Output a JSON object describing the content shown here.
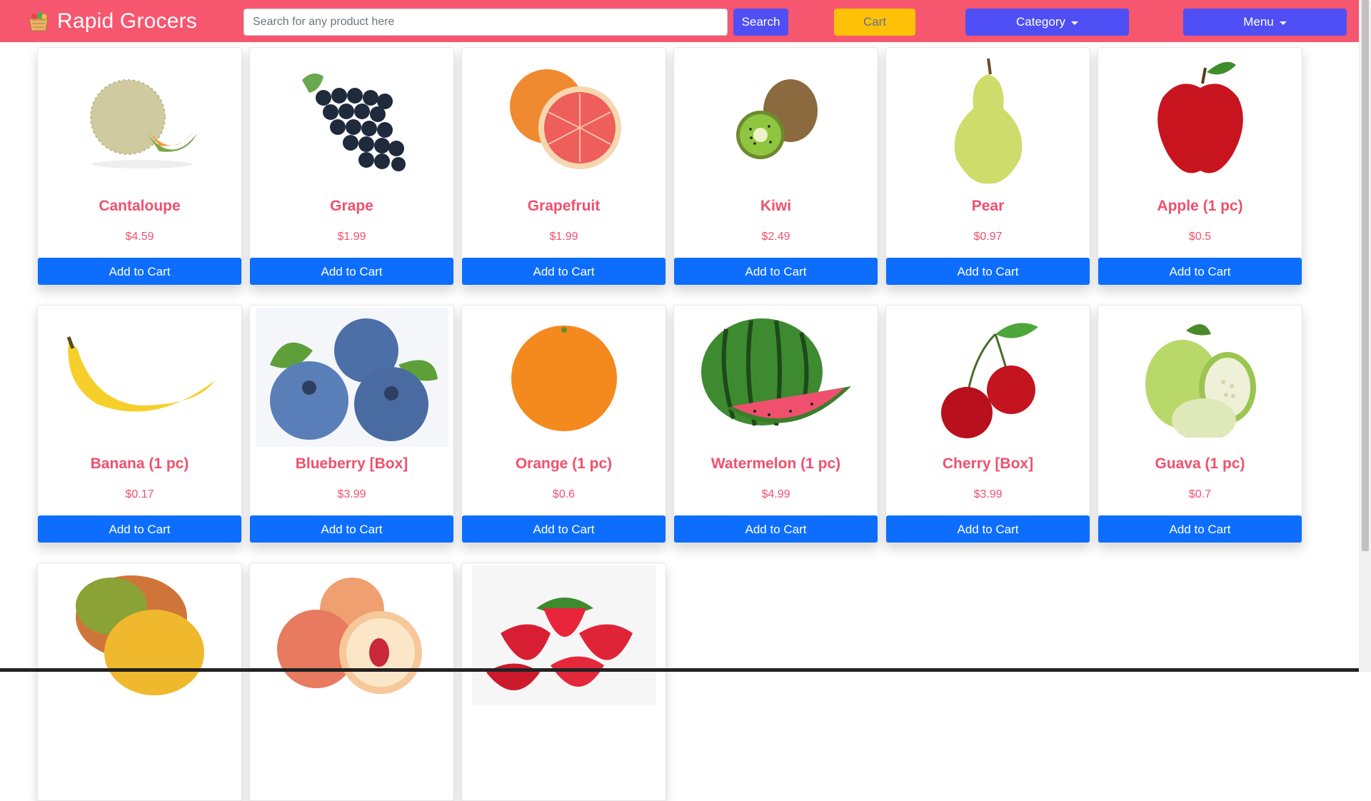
{
  "header": {
    "brand_name": "Rapid Grocers",
    "search_placeholder": "Search for any product here",
    "search_label": "Search",
    "cart_label": "Cart",
    "category_label": "Category",
    "menu_label": "Menu"
  },
  "colors": {
    "navbar": "#f7566f",
    "primary_button": "#4f4ff5",
    "cart_button": "#ffc107",
    "add_to_cart": "#0d6efd",
    "product_text": "#f0506e"
  },
  "products": [
    {
      "name": "Cantaloupe",
      "price": "$4.59",
      "button": "Add to Cart",
      "icon": "cantaloupe-image"
    },
    {
      "name": "Grape",
      "price": "$1.99",
      "button": "Add to Cart",
      "icon": "grape-image"
    },
    {
      "name": "Grapefruit",
      "price": "$1.99",
      "button": "Add to Cart",
      "icon": "grapefruit-image"
    },
    {
      "name": "Kiwi",
      "price": "$2.49",
      "button": "Add to Cart",
      "icon": "kiwi-image"
    },
    {
      "name": "Pear",
      "price": "$0.97",
      "button": "Add to Cart",
      "icon": "pear-image"
    },
    {
      "name": "Apple (1 pc)",
      "price": "$0.5",
      "button": "Add to Cart",
      "icon": "apple-image"
    },
    {
      "name": "Banana (1 pc)",
      "price": "$0.17",
      "button": "Add to Cart",
      "icon": "banana-image"
    },
    {
      "name": "Blueberry [Box]",
      "price": "$3.99",
      "button": "Add to Cart",
      "icon": "blueberry-image"
    },
    {
      "name": "Orange (1 pc)",
      "price": "$0.6",
      "button": "Add to Cart",
      "icon": "orange-image"
    },
    {
      "name": "Watermelon (1 pc)",
      "price": "$4.99",
      "button": "Add to Cart",
      "icon": "watermelon-image"
    },
    {
      "name": "Cherry [Box]",
      "price": "$3.99",
      "button": "Add to Cart",
      "icon": "cherry-image"
    },
    {
      "name": "Guava (1 pc)",
      "price": "$0.7",
      "button": "Add to Cart",
      "icon": "guava-image"
    },
    {
      "name": "",
      "price": "",
      "button": "",
      "icon": "mango-image"
    },
    {
      "name": "",
      "price": "",
      "button": "",
      "icon": "peach-image"
    },
    {
      "name": "",
      "price": "",
      "button": "",
      "icon": "strawberry-image"
    }
  ]
}
